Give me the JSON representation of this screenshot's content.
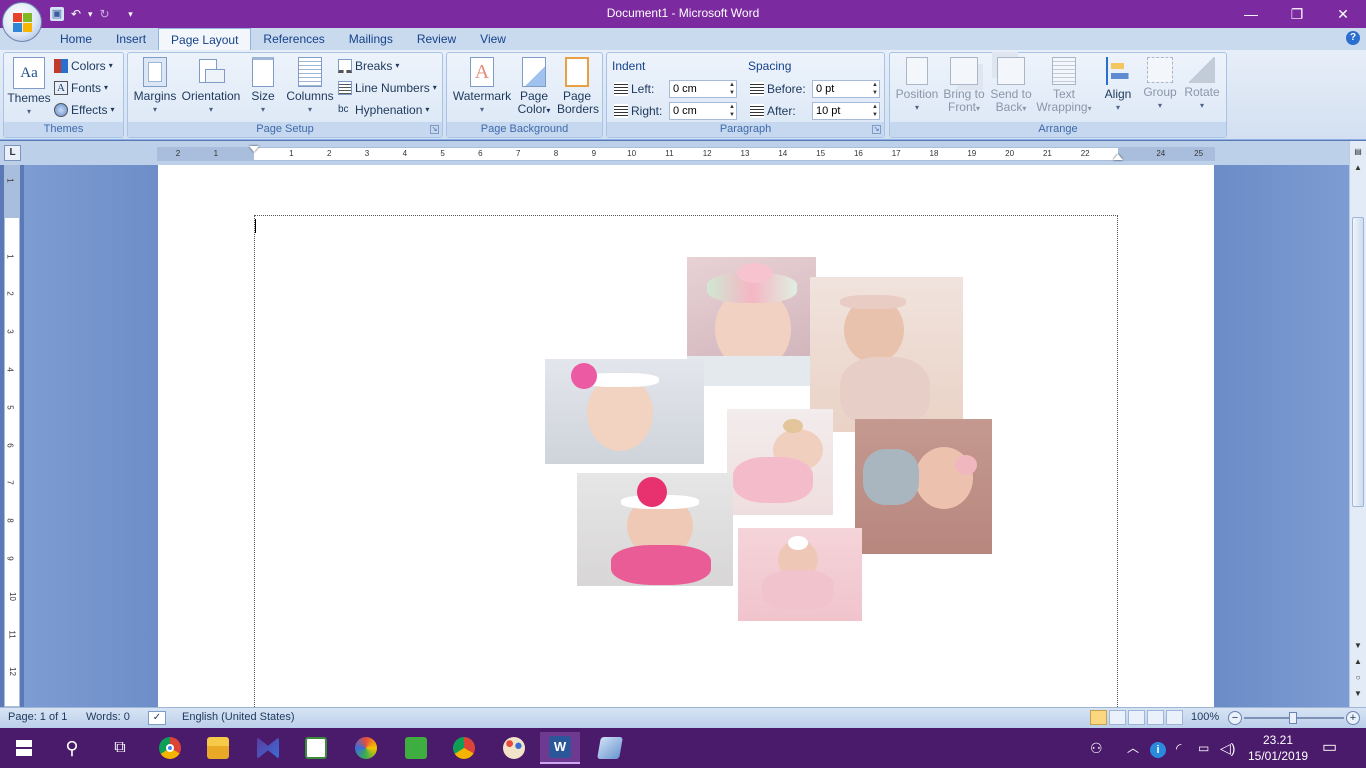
{
  "window": {
    "title": "Document1 - Microsoft Word",
    "minimize": "—",
    "restore": "❐",
    "close": "✕"
  },
  "qat": {
    "save": "💾",
    "undo": "↶",
    "undo_dd": "▾",
    "redo": "↻",
    "customize": "▾"
  },
  "tabs": [
    "Home",
    "Insert",
    "Page Layout",
    "References",
    "Mailings",
    "Review",
    "View"
  ],
  "active_tab": "Page Layout",
  "help": "?",
  "ribbon": {
    "themes": {
      "themes_label": "Themes",
      "colors": "Colors",
      "fonts": "Fonts",
      "effects": "Effects",
      "group": "Themes"
    },
    "page_setup": {
      "margins": "Margins",
      "orientation": "Orientation",
      "size": "Size",
      "columns": "Columns",
      "breaks": "Breaks",
      "line_numbers": "Line Numbers",
      "hyphenation": "Hyphenation",
      "group": "Page Setup"
    },
    "page_background": {
      "watermark": "Watermark",
      "page_color_1": "Page",
      "page_color_2": "Color",
      "page_borders_1": "Page",
      "page_borders_2": "Borders",
      "group": "Page Background"
    },
    "paragraph": {
      "indent": "Indent",
      "left_label": "Left:",
      "left_value": "0 cm",
      "right_label": "Right:",
      "right_value": "0 cm",
      "spacing": "Spacing",
      "before_label": "Before:",
      "before_value": "0 pt",
      "after_label": "After:",
      "after_value": "10 pt",
      "group": "Paragraph"
    },
    "arrange": {
      "position": "Position",
      "bring_front_1": "Bring to",
      "bring_front_2": "Front",
      "send_back_1": "Send to",
      "send_back_2": "Back",
      "text_wrap_1": "Text",
      "text_wrap_2": "Wrapping",
      "align": "Align",
      "group_btn": "Group",
      "rotate": "Rotate",
      "group": "Arrange"
    }
  },
  "ruler": {
    "corner": "L",
    "h_ticks": [
      "2",
      "1",
      "",
      "1",
      "2",
      "3",
      "4",
      "5",
      "6",
      "7",
      "8",
      "9",
      "10",
      "11",
      "12",
      "13",
      "14",
      "15",
      "16",
      "17",
      "18",
      "19",
      "20",
      "21",
      "22",
      "",
      "24",
      "25"
    ],
    "v_ticks": [
      "1",
      "",
      "1",
      "2",
      "3",
      "4",
      "5",
      "6",
      "7",
      "8",
      "9",
      "10",
      "11",
      "12"
    ]
  },
  "status": {
    "page": "Page: 1 of 1",
    "words": "Words: 0",
    "language": "English (United States)",
    "zoom": "100%",
    "zoom_minus": "−",
    "zoom_plus": "+"
  },
  "taskbar": {
    "time": "23.21",
    "date": "15/01/2019"
  }
}
